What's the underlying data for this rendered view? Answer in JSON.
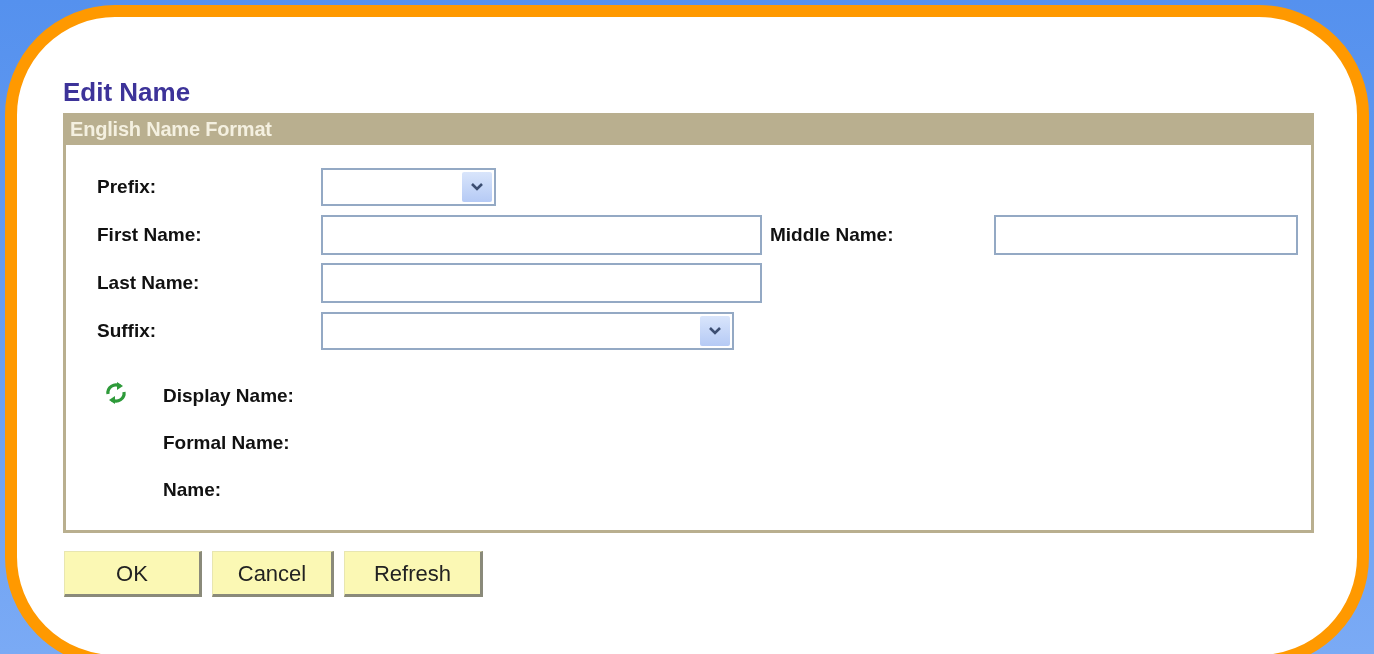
{
  "title": "Edit Name",
  "section": {
    "header": "English Name Format",
    "rows": [
      [
        {
          "label": "Prefix:",
          "kind": "select"
        }
      ],
      [
        {
          "label": "First Name:",
          "kind": "text"
        },
        {
          "label": "Middle Name:",
          "kind": "text"
        }
      ],
      [
        {
          "label": "Last Name:",
          "kind": "text"
        }
      ],
      [
        {
          "label": "Suffix:",
          "kind": "select"
        }
      ]
    ],
    "display_labels": [
      "Display Name:",
      "Formal Name:",
      "Name:"
    ]
  },
  "buttons": [
    "OK",
    "Cancel",
    "Refresh"
  ]
}
